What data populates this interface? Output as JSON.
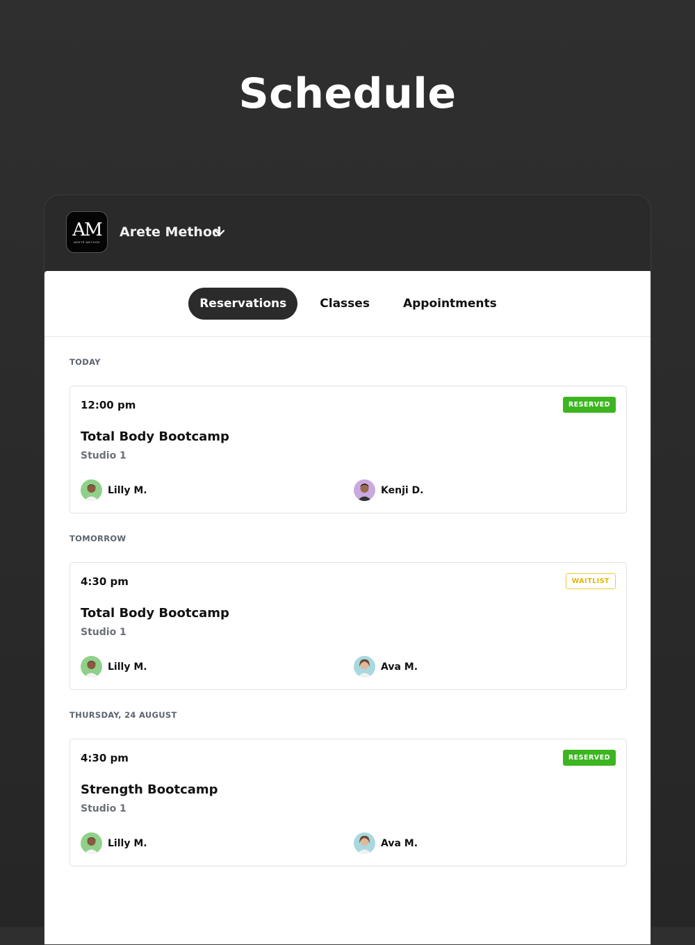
{
  "page": {
    "title": "Schedule"
  },
  "studio": {
    "logo_text": "AM",
    "logo_sub": "ARETÉ METHOD",
    "name": "Arete Method"
  },
  "tabs": [
    {
      "label": "Reservations",
      "active": true
    },
    {
      "label": "Classes",
      "active": false
    },
    {
      "label": "Appointments",
      "active": false
    }
  ],
  "sections": [
    {
      "label": "TODAY",
      "card": {
        "time": "12:00 pm",
        "status": "RESERVED",
        "title": "Total Body Bootcamp",
        "room": "Studio 1",
        "people": [
          "Lilly M.",
          "Kenji D."
        ]
      }
    },
    {
      "label": "TOMORROW",
      "card": {
        "time": "4:30 pm",
        "status": "WAITLIST",
        "title": "Total Body Bootcamp",
        "room": "Studio 1",
        "people": [
          "Lilly M.",
          "Ava M."
        ]
      }
    },
    {
      "label": "THURSDAY, 24 AUGUST",
      "card": {
        "time": "4:30 pm",
        "status": "RESERVED",
        "title": "Strength Bootcamp",
        "room": "Studio 1",
        "people": [
          "Lilly M.",
          "Ava M."
        ]
      }
    }
  ],
  "colors": {
    "reserved": "#3cb521",
    "waitlist": "#e2b600",
    "background": "#2a2a2a",
    "active_tab": "#2b2b2b"
  }
}
